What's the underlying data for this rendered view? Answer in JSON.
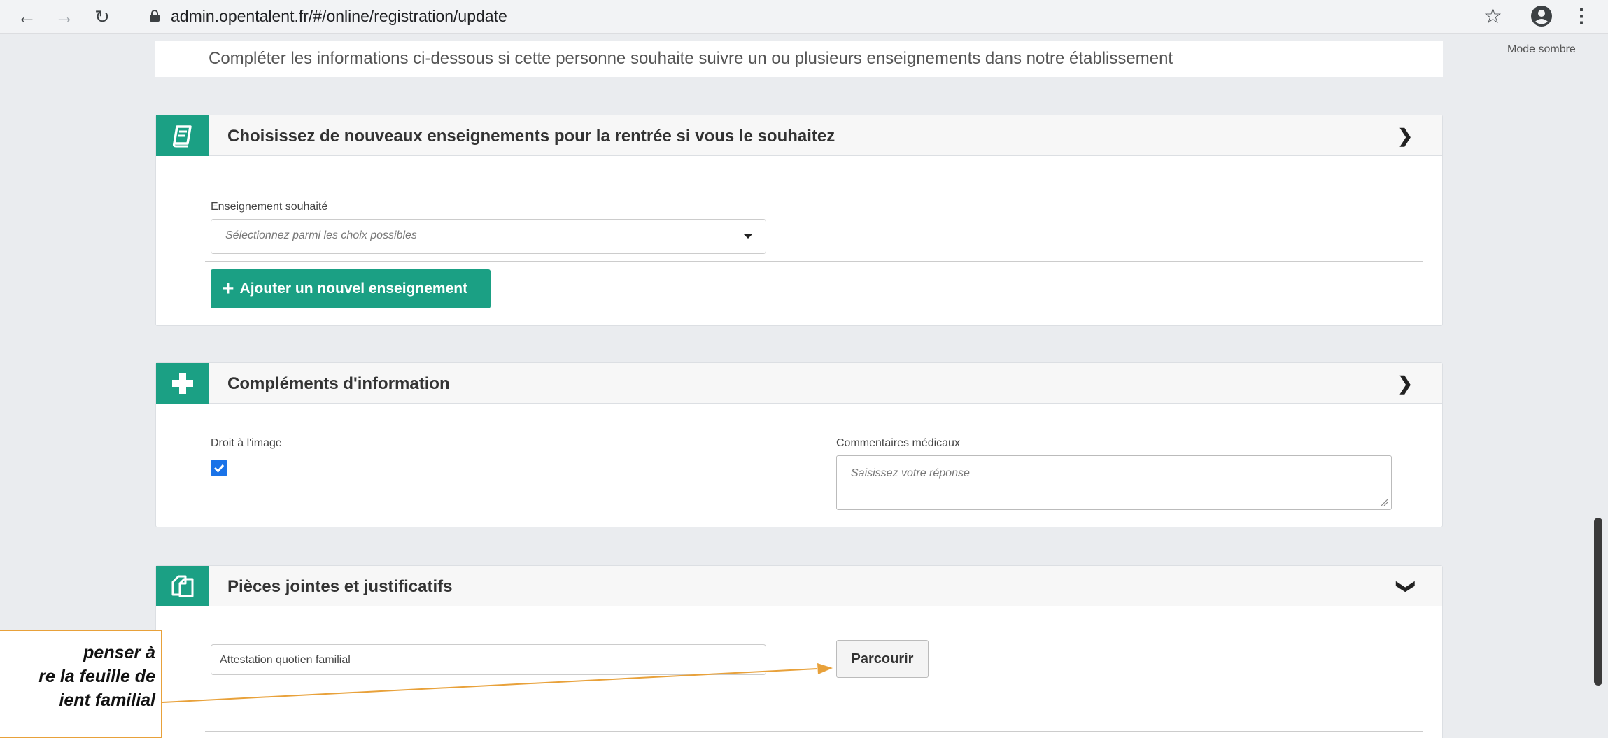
{
  "browser": {
    "url": "admin.opentalent.fr/#/online/registration/update"
  },
  "page": {
    "dark_mode_label": "Mode sombre",
    "intro_text": "Compléter les informations ci-dessous si cette personne souhaite suivre un ou plusieurs enseignements dans notre établissement"
  },
  "sections": {
    "courses": {
      "title": "Choisissez de nouveaux enseignements pour la rentrée si vous le souhaitez",
      "field_label": "Enseignement souhaité",
      "select_placeholder": "Sélectionnez parmi les choix possibles",
      "add_button_label": "Ajouter un nouvel enseignement",
      "icon": "book-icon",
      "state": "collapsed-chevron-right"
    },
    "complements": {
      "title": "Compléments d'information",
      "image_rights_label": "Droit à l'image",
      "image_rights_checked": true,
      "medical_label": "Commentaires médicaux",
      "medical_placeholder": "Saisissez votre réponse",
      "icon": "plus-icon",
      "state": "collapsed-chevron-right"
    },
    "attachments": {
      "title": "Pièces jointes et justificatifs",
      "file_field_text": "Attestation quotien familial",
      "browse_label": "Parcourir",
      "icon": "documents-icon",
      "state": "expanded-chevron-down"
    }
  },
  "annotation": {
    "lines": [
      "penser à",
      "re la feuille de",
      "ient familial"
    ]
  },
  "colors": {
    "accent": "#1ba084",
    "annotation_border": "#e8a13a",
    "checkbox": "#1a73e8"
  }
}
